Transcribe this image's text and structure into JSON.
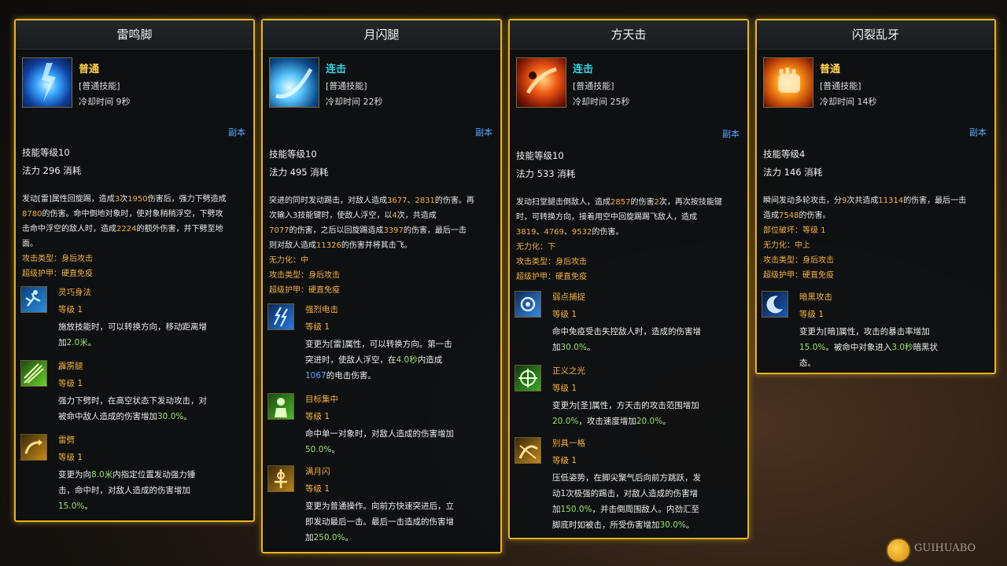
{
  "cards": [
    {
      "title": "雷鸣脚",
      "rank": "普通",
      "rank_color": "#ffd34a",
      "skill_type": "[普通技能]",
      "cooldown": "冷却时间 9秒",
      "dungeon": "副本",
      "level": "技能等级10",
      "mana": "法力 296 消耗",
      "icon": "lightning-kick-icon",
      "desc_html": "发动[雷]属性回旋踢，造成<span class='hl'>3</span>次<span class='hl'>1950</span>伤害后，强力下劈造成<br><span class='hl'>8780</span>的伤害。命中倒地对象时，使对象稍稍浮空，下劈攻<br>击命中浮空的敌人时，造成<span class='hl'>2224</span>的额外伤害，并下劈至地<br>面。<br><span class='attr'>攻击类型：身后攻击</span><br><span class='attr'>超级护甲：硬直免疫</span>",
      "runes": [
        {
          "name": "灵巧身法",
          "level": "等级 1",
          "icon": "dash-icon",
          "desc_html": "施放技能时，可以转换方向，移动距离增<br>加<span class='g'>2.0米</span>。"
        },
        {
          "name": "霹雳腿",
          "level": "等级 1",
          "icon": "thunder-leg-icon",
          "desc_html": "强力下劈时，在高空状态下发动攻击，对<br>被命中敌人造成的伤害增加<span class='g'>30.0%</span>。"
        },
        {
          "name": "雷劈",
          "level": "等级 1",
          "icon": "thunder-strike-icon",
          "desc_html": "变更为向<span class='g'>8.0米</span>内指定位置发动强力锤<br>击，命中时，对敌人造成的伤害增加<br><span class='g'>15.0%</span>。"
        }
      ]
    },
    {
      "title": "月闪腿",
      "rank": "连击",
      "rank_color": "#38d6e6",
      "skill_type": "[普通技能]",
      "cooldown": "冷却时间 22秒",
      "dungeon": "副本",
      "level": "技能等级10",
      "mana": "法力 495 消耗",
      "icon": "moon-flash-kick-icon",
      "desc_html": "突进的同时发动踢击，对敌人造成<span class='hl'>3677</span>、<span class='hl'>2831</span>的伤害。再<br>次输入3技能键时，使敌人浮空，以<span class='hl'>4</span>次，共造成<br><span class='hl'>7077</span>的伤害，之后以回旋踢造成<span class='hl'>3397</span>的伤害，最后一击<br>则对敌人造成<span class='hl'>11326</span>的伤害并将其击飞。<br><span class='attr'>无力化：中</span><br><span class='attr'>攻击类型：身后攻击</span><br><span class='attr'>超级护甲：硬直免疫</span>",
      "runes": [
        {
          "name": "强烈电击",
          "level": "等级 1",
          "icon": "strong-shock-icon",
          "desc_html": "变更为[雷]属性，可以转换方向。第一击<br>突进时，使敌人浮空，在<span class='g'>4.0秒</span>内造成<br><span class='b'>1067</span>的电击伤害。"
        },
        {
          "name": "目标集中",
          "level": "等级 1",
          "icon": "target-focus-icon",
          "desc_html": "命中单一对象时，对敌人造成的伤害增加<br><span class='g'>50.0%</span>。"
        },
        {
          "name": "满月闪",
          "level": "等级 1",
          "icon": "full-moon-icon",
          "desc_html": "变更为普通操作。向前方快速突进后，立<br>即发动最后一击。最后一击造成的伤害增<br>加<span class='g'>250.0%</span>。"
        }
      ]
    },
    {
      "title": "方天击",
      "rank": "连击",
      "rank_color": "#38d6e6",
      "skill_type": "[普通技能]",
      "cooldown": "冷却时间 25秒",
      "dungeon": "副本",
      "level": "技能等级10",
      "mana": "法力 533 消耗",
      "icon": "sky-strike-icon",
      "desc_html": "发动扫堂腿击倒敌人，造成<span class='hl'>2857</span>的伤害<span class='hl'>2</span>次，再次按技能键<br>时，可转换方向，接着用空中回旋踢踢飞敌人，造成<br><span class='hl'>3819</span>、<span class='hl'>4769</span>、<span class='hl'>9532</span>的伤害。<br><span class='attr'>无力化：下</span><br><span class='attr'>攻击类型：身后攻击</span><br><span class='attr'>超级护甲：硬直免疫</span>",
      "runes": [
        {
          "name": "弱点捕捉",
          "level": "等级 1",
          "icon": "weakness-icon",
          "desc_html": "命中免疫受击失控敌人时，造成的伤害增<br>加<span class='g'>30.0%</span>。"
        },
        {
          "name": "正义之光",
          "level": "等级 1",
          "icon": "holy-light-icon",
          "desc_html": "变更为[圣]属性，方天击的攻击范围增加<br><span class='g'>20.0%</span>，攻击速度增加<span class='g'>20.0%</span>。"
        },
        {
          "name": "别具一格",
          "level": "等级 1",
          "icon": "unique-style-icon",
          "desc_html": "压低姿势，在脚尖聚气后向前方跳跃，发<br>动1次极强的踢击，对敌人造成的伤害增<br>加<span class='g'>150.0%</span>，并击倒周围敌人。内劲汇至<br>脚底时如被击，所受伤害增加<span class='g'>30.0%</span>。"
        }
      ]
    },
    {
      "title": "闪裂乱牙",
      "rank": "普通",
      "rank_color": "#ffd34a",
      "skill_type": "[普通技能]",
      "cooldown": "冷却时间 14秒",
      "dungeon": "副本",
      "level": "技能等级4",
      "mana": "法力 146 消耗",
      "icon": "fist-icon",
      "desc_html": "瞬间发动多轮攻击，分<span class='hl'>9</span>次共造成<span class='hl'>11314</span>的伤害，最后一击<br>造成<span class='hl'>7548</span>的伤害。<br><span class='attr'>部位破坏：等级 1</span><br><span class='attr'>无力化：中上</span><br><span class='attr'>攻击类型：身后攻击</span><br><span class='attr'>超级护甲：硬直免疫</span>",
      "runes": [
        {
          "name": "暗黑攻击",
          "level": "等级 1",
          "icon": "dark-moon-icon",
          "desc_html": "变更为[暗]属性，攻击的暴击率增加<br><span class='g'>15.0%</span>。被命中对象进入<span class='g'>3.0秒</span>暗黑状<br>态。"
        }
      ]
    }
  ],
  "watermark": "GUIHUABO"
}
